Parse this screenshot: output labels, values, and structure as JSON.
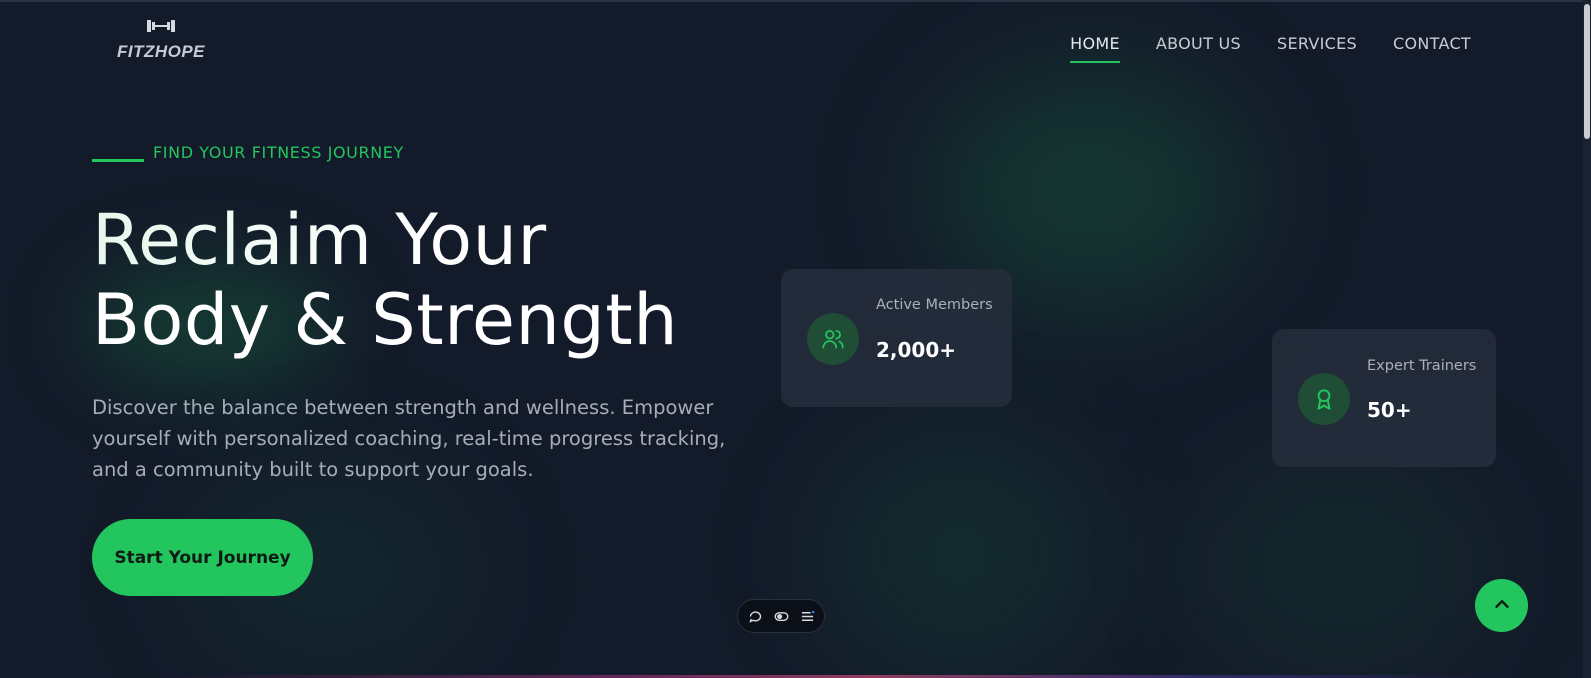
{
  "brand": {
    "logo_text": "FITZHOPE",
    "logo_mark": "dumbbell-mark"
  },
  "nav": {
    "items": [
      {
        "label": "HOME",
        "active": true
      },
      {
        "label": "ABOUT US",
        "active": false
      },
      {
        "label": "SERVICES",
        "active": false
      },
      {
        "label": "CONTACT",
        "active": false
      }
    ]
  },
  "hero": {
    "eyebrow": "FIND YOUR FITNESS JOURNEY",
    "headline_line1": "Reclaim Your",
    "headline_line2": "Body & Strength",
    "description": "Discover the balance between strength and wellness. Empower yourself with personalized coaching, real-time progress tracking, and a community built to support your goals.",
    "cta_label": "Start Your Journey"
  },
  "stats": [
    {
      "label": "Active Members",
      "value": "2,000+",
      "icon": "users-icon"
    },
    {
      "label": "Expert Trainers",
      "value": "50+",
      "icon": "award-icon"
    }
  ],
  "toolbar": {
    "icons": [
      "comment-icon",
      "toggle-icon",
      "list-icon"
    ]
  },
  "scroll_top": {
    "icon": "chevron-up-icon"
  },
  "colors": {
    "background": "#131a29",
    "accent": "#22c55e",
    "card": "#262e3c",
    "text_muted": "#a6adba"
  }
}
